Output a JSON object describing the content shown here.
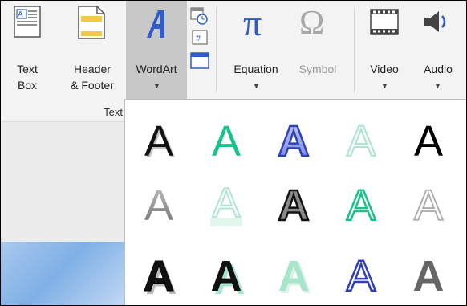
{
  "ribbon": {
    "text_box": {
      "line1": "Text",
      "line2": "Box"
    },
    "header_footer": {
      "line1": "Header",
      "line2": "& Footer"
    },
    "wordart": {
      "label": "WordArt"
    },
    "equation": {
      "label": "Equation"
    },
    "symbol": {
      "label": "Symbol"
    },
    "video": {
      "label": "Video"
    },
    "audio": {
      "label": "Audio"
    },
    "group_label": "Text"
  },
  "gallery": {
    "glyph": "A",
    "rows": [
      [
        "black-shadow",
        "teal-solid",
        "blue-gradient-outline",
        "light-outline",
        "black-bold"
      ],
      [
        "gray-gradient",
        "mint-reflection",
        "gray-outline-dark",
        "teal-outline",
        "light-gray-outline"
      ],
      [
        "black-outline-shadow",
        "black-teal-shadow",
        "mint-shadow",
        "blue-outline-white",
        "gray-bold"
      ]
    ]
  },
  "colors": {
    "accent": "#2f5cc8",
    "teal": "#19c28a",
    "mint": "#a8e6cc"
  }
}
